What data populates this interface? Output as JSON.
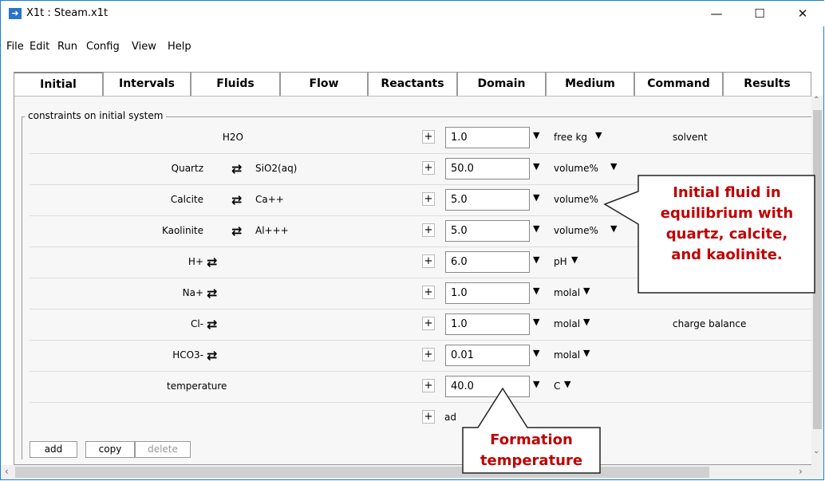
{
  "window": {
    "title": "X1t : Steam.x1t",
    "minimize": "—",
    "maximize": "☐",
    "close": "✕",
    "app_icon": "arrow-icon"
  },
  "menu": [
    "File",
    "Edit",
    "Run",
    "Config",
    "View",
    "Help"
  ],
  "tabs": [
    "Initial",
    "Intervals",
    "Fluids",
    "Flow",
    "Reactants",
    "Domain",
    "Medium",
    "Command",
    "Results"
  ],
  "active_tab": "Initial",
  "group_title": "constraints on initial system",
  "rows": [
    {
      "species": "H2O",
      "swap": "",
      "coupled": "",
      "value": "1.0",
      "unit": "free kg",
      "note": "solvent"
    },
    {
      "species": "Quartz",
      "swap": "⇄",
      "coupled": "SiO2(aq)",
      "value": "50.0",
      "unit": "volume%",
      "note": ""
    },
    {
      "species": "Calcite",
      "swap": "⇄",
      "coupled": "Ca++",
      "value": "5.0",
      "unit": "volume%",
      "note": ""
    },
    {
      "species": "Kaolinite",
      "swap": "⇄",
      "coupled": "Al+++",
      "value": "5.0",
      "unit": "volume%",
      "note": ""
    },
    {
      "species": "H+",
      "swap": "⇄",
      "coupled": "",
      "value": "6.0",
      "unit": "pH",
      "note": ""
    },
    {
      "species": "Na+",
      "swap": "⇄",
      "coupled": "",
      "value": "1.0",
      "unit": "molal",
      "note": ""
    },
    {
      "species": "Cl-",
      "swap": "⇄",
      "coupled": "",
      "value": "1.0",
      "unit": "molal",
      "note": "charge balance"
    },
    {
      "species": "HCO3-",
      "swap": "⇄",
      "coupled": "",
      "value": "0.01",
      "unit": "molal",
      "note": ""
    },
    {
      "species": "temperature",
      "swap": "",
      "coupled": "",
      "value": "40.0",
      "unit": "C",
      "note": ""
    }
  ],
  "advanced_label": "ad",
  "plus": "+",
  "dropdown": "▼",
  "buttons": {
    "add": "add",
    "copy": "copy",
    "delete": "delete"
  },
  "callout_1": [
    "Initial fluid in",
    "equilibrium with",
    "quartz, calcite,",
    "and kaolinite."
  ],
  "callout_2": [
    "Formation",
    "temperature"
  ],
  "colors": {
    "callout_text": "#c00000",
    "window_border": "#1a7fd4"
  }
}
